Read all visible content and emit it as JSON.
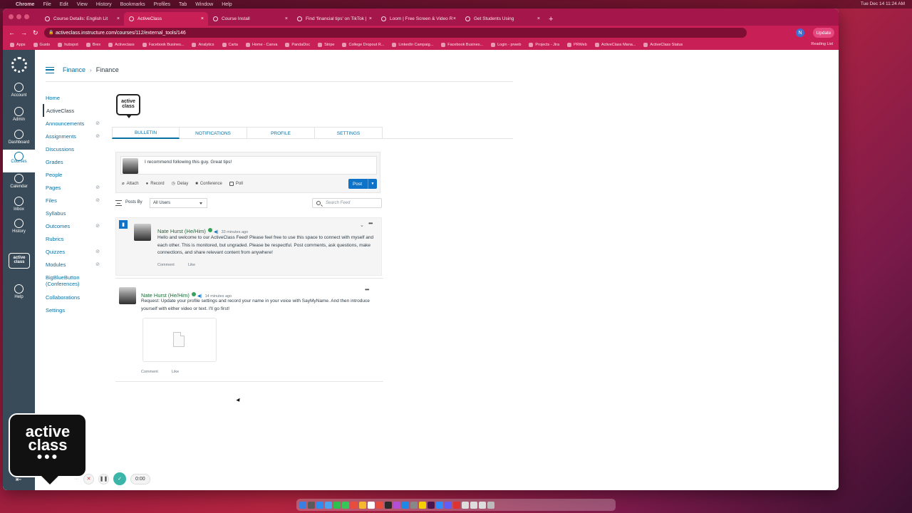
{
  "mac_menu": {
    "items": [
      "Chrome",
      "File",
      "Edit",
      "View",
      "History",
      "Bookmarks",
      "Profiles",
      "Tab",
      "Window",
      "Help"
    ],
    "clock": "Tue Dec 14  11:24 AM"
  },
  "browser": {
    "tabs": [
      {
        "label": "Course Details: English Lit",
        "active": false
      },
      {
        "label": "ActiveClass",
        "active": true
      },
      {
        "label": "Course Install",
        "active": false
      },
      {
        "label": "Find 'financial tips' on TikTok |",
        "active": false
      },
      {
        "label": "Loom | Free Screen & Video R",
        "active": false
      },
      {
        "label": "Get Students Using",
        "active": false
      }
    ],
    "url": "activeclass.instructure.com/courses/112/external_tools/146",
    "update_label": "Update",
    "profile_initial": "N",
    "bookmarks": [
      "Apps",
      "Gusto",
      "hubspot",
      "Brex",
      "Activeclass",
      "Facebook Busines...",
      "Analytics",
      "Carta",
      "Home - Canva",
      "PandaDoc",
      "Stripe",
      "College Dropout R...",
      "LinkedIn Campaig...",
      "Facebook Busines...",
      "Login - prweb",
      "Projects - Jira",
      "PRWeb",
      "ActiveClass Mana...",
      "ActiveClass Status"
    ],
    "reading_list": "Reading List"
  },
  "global_nav": [
    {
      "label": "Account",
      "icon": "account-icon"
    },
    {
      "label": "Admin",
      "icon": "admin-shield-icon"
    },
    {
      "label": "Dashboard",
      "icon": "dashboard-icon"
    },
    {
      "label": "Courses",
      "icon": "courses-icon",
      "active": true
    },
    {
      "label": "Calendar",
      "icon": "calendar-icon"
    },
    {
      "label": "Inbox",
      "icon": "inbox-icon"
    },
    {
      "label": "History",
      "icon": "history-icon"
    },
    {
      "label": "Help",
      "icon": "help-icon"
    }
  ],
  "nav_app_logo": "active class",
  "breadcrumb": {
    "course": "Finance",
    "current": "Finance"
  },
  "course_nav": [
    {
      "label": "Home",
      "hidden": false
    },
    {
      "label": "ActiveClass",
      "hidden": false,
      "active": true
    },
    {
      "label": "Announcements",
      "hidden": true
    },
    {
      "label": "Assignments",
      "hidden": true
    },
    {
      "label": "Discussions",
      "hidden": false
    },
    {
      "label": "Grades",
      "hidden": false
    },
    {
      "label": "People",
      "hidden": false
    },
    {
      "label": "Pages",
      "hidden": true
    },
    {
      "label": "Files",
      "hidden": true
    },
    {
      "label": "Syllabus",
      "hidden": false
    },
    {
      "label": "Outcomes",
      "hidden": true
    },
    {
      "label": "Rubrics",
      "hidden": false
    },
    {
      "label": "Quizzes",
      "hidden": true
    },
    {
      "label": "Modules",
      "hidden": true
    },
    {
      "label": "BigBlueButton (Conferences)",
      "hidden": false
    },
    {
      "label": "Collaborations",
      "hidden": false
    },
    {
      "label": "Settings",
      "hidden": false
    }
  ],
  "app_logo_text": "active class",
  "app_tabs": [
    "BULLETIN",
    "NOTIFICATIONS",
    "PROFILE",
    "SETTINGS"
  ],
  "composer": {
    "value": "I recommend following this guy. Great tips!",
    "tools": [
      "Attach",
      "Record",
      "Delay",
      "Conference",
      "Poll"
    ],
    "post_label": "Post"
  },
  "filter": {
    "label": "Posts By",
    "selected": "All Users",
    "search_placeholder": "Search Feed"
  },
  "posts": [
    {
      "author": "Nate Hurst (He/Him)",
      "time": "33 minutes ago",
      "body": "Hello and welcome to our ActiveClass Feed! Please feel free to use this space to connect with myself and each other. This is monitored, but ungraded. Please be respectful. Post comments, ask questions, make connections, and share relevant content from anywhere!",
      "comment": "Comment",
      "like": "Like",
      "pinned": true
    },
    {
      "author": "Nate Hurst (He/Him)",
      "time": "14 minutes ago",
      "body": "Request: Update your profile settings and record your name in your voice with SayMyName. And then introduce yourself with either video or text. I'll go first!",
      "comment": "Comment",
      "like": "Like",
      "pinned": false
    }
  ],
  "overlay_logo": {
    "line1": "active",
    "line2": "class"
  },
  "loom": {
    "time": "0:00"
  },
  "colors": {
    "canvas_nav": "#394b58",
    "link": "#0770a3",
    "post_button": "#0f73c7",
    "browser_chrome": "#c91f57"
  }
}
